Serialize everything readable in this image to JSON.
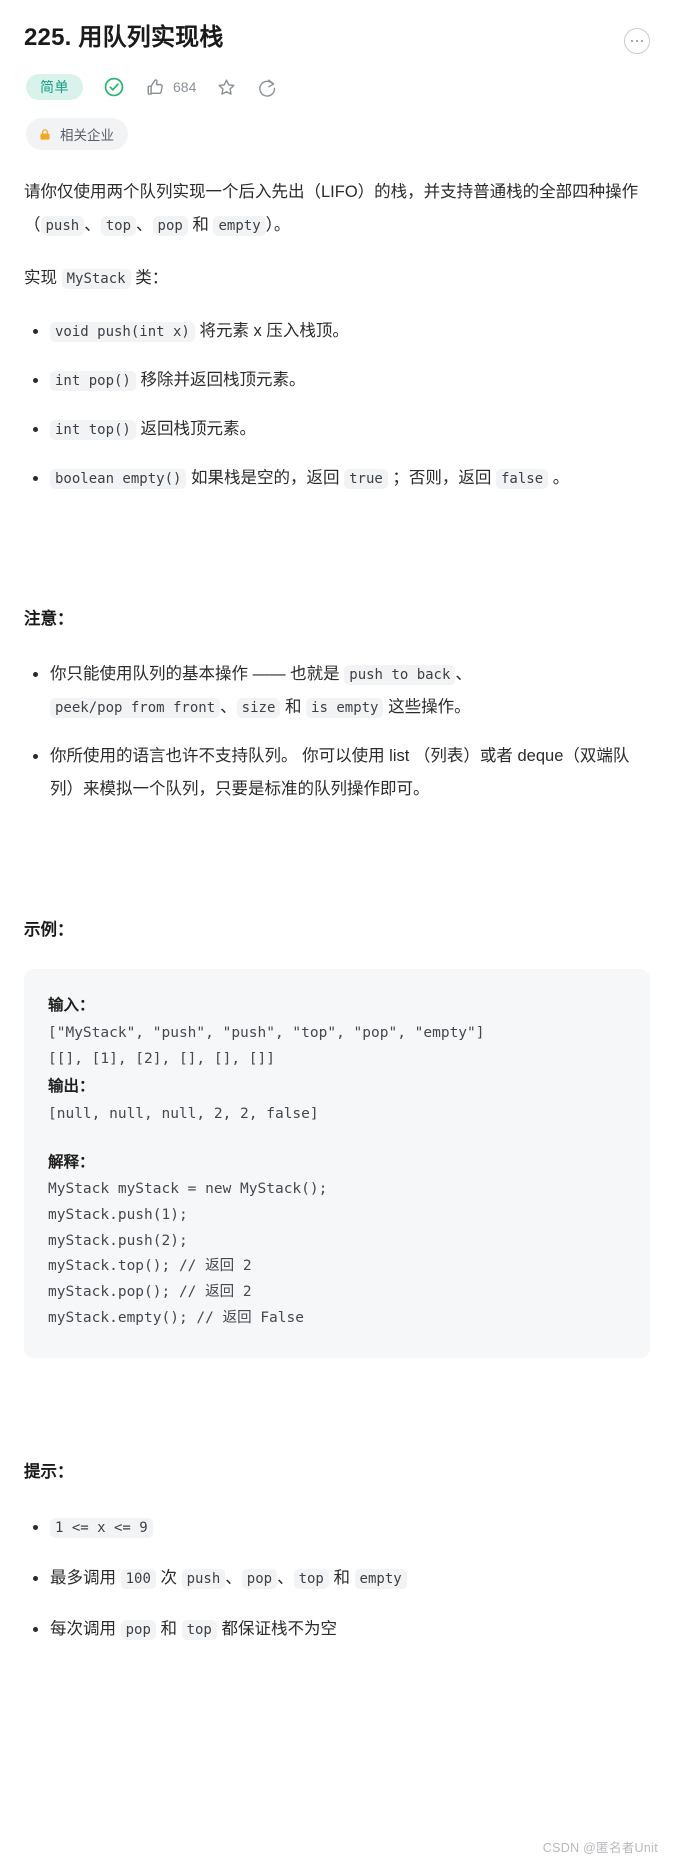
{
  "header": {
    "title": "225. 用队列实现栈",
    "more_icon": "more-horizontal-icon",
    "difficulty": "简单",
    "solved_icon": "check-circle-icon",
    "like_icon": "thumbs-up-icon",
    "like_count": "684",
    "favorite_icon": "star-icon",
    "share_icon": "share-icon",
    "company_tag": {
      "lock_icon": "lock-icon",
      "label": "相关企业"
    }
  },
  "colors": {
    "difficulty_bg": "#d9f2ec",
    "difficulty_text": "#16a085",
    "solved_green": "#00af9b",
    "lock_orange": "#f5a623",
    "code_bg": "#f2f3f5",
    "example_bg": "#f6f7f8"
  },
  "description": {
    "intro_part1": "请你仅使用两个队列实现一个后入先出（LIFO）的栈，并支持普通栈的全部四种操作（",
    "op_push": "push",
    "sep1": "、",
    "op_top": "top",
    "sep2": "、",
    "op_pop": "pop",
    "and_text": " 和 ",
    "op_empty": "empty",
    "intro_end": "）。",
    "implement_prefix": "实现 ",
    "class_name": "MyStack",
    "implement_suffix": " 类：",
    "methods": [
      {
        "code": "void push(int x)",
        "text": " 将元素 x 压入栈顶。"
      },
      {
        "code": "int pop()",
        "text": " 移除并返回栈顶元素。"
      },
      {
        "code": "int top()",
        "text": " 返回栈顶元素。"
      }
    ],
    "empty_method": {
      "code": "boolean empty()",
      "text1": " 如果栈是空的，返回 ",
      "code_true": "true",
      "text2": " ；否则，返回 ",
      "code_false": "false",
      "text3": " 。"
    }
  },
  "note": {
    "heading": "注意：",
    "item1": {
      "text1": "你只能使用队列的基本操作 —— 也就是 ",
      "code1": "push to back",
      "text2": "、",
      "code2": "peek/pop from front",
      "text3": "、",
      "code3": "size",
      "text4": " 和 ",
      "code4": "is empty",
      "text5": " 这些操作。"
    },
    "item2": "你所使用的语言也许不支持队列。 你可以使用 list （列表）或者 deque（双端队列）来模拟一个队列，只要是标准的队列操作即可。"
  },
  "example": {
    "heading": "示例：",
    "input_label": "输入：",
    "input_lines": "[\"MyStack\", \"push\", \"push\", \"top\", \"pop\", \"empty\"]\n[[], [1], [2], [], [], []]",
    "output_label": "输出：",
    "output_lines": "[null, null, null, 2, 2, false]",
    "explain_label": "解释：",
    "explain_lines": "MyStack myStack = new MyStack();\nmyStack.push(1);\nmyStack.push(2);\nmyStack.top(); // 返回 2\nmyStack.pop(); // 返回 2\nmyStack.empty(); // 返回 False"
  },
  "hints": {
    "heading": "提示：",
    "item1_code": "1 <= x <= 9",
    "item2": {
      "text1": "最多调用 ",
      "code1": "100",
      "text2": " 次 ",
      "code2": "push",
      "text3": "、",
      "code3": "pop",
      "text4": "、",
      "code4": "top",
      "text5": " 和 ",
      "code5": "empty"
    },
    "item3": {
      "text1": "每次调用 ",
      "code1": "pop",
      "text2": " 和 ",
      "code2": "top",
      "text3": " 都保证栈不为空"
    }
  },
  "watermark": "CSDN @匿名者Unit"
}
